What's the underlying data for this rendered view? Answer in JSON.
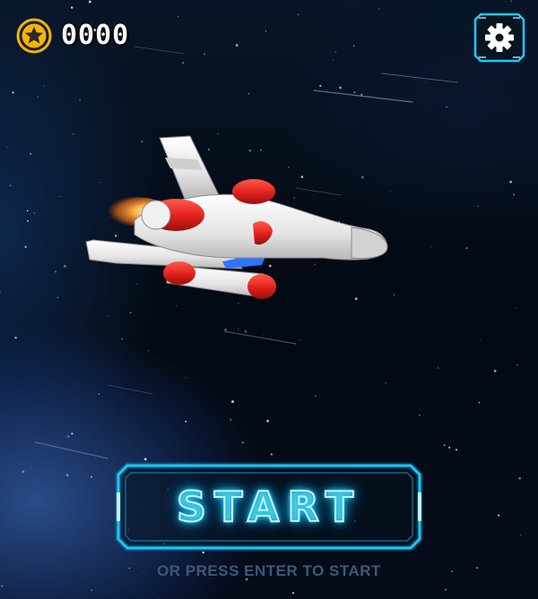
{
  "hud": {
    "coins": "0000",
    "coin_icon": "star-coin-icon",
    "settings_icon": "gear-icon"
  },
  "start": {
    "label": "START",
    "hint": "OR PRESS ENTER TO START"
  },
  "colors": {
    "neon_cyan": "#19c9ff",
    "coin_gold": "#f5b400",
    "ship_white": "#eeeeee",
    "ship_red": "#e0201c",
    "hint_text": "#3d5a78"
  }
}
